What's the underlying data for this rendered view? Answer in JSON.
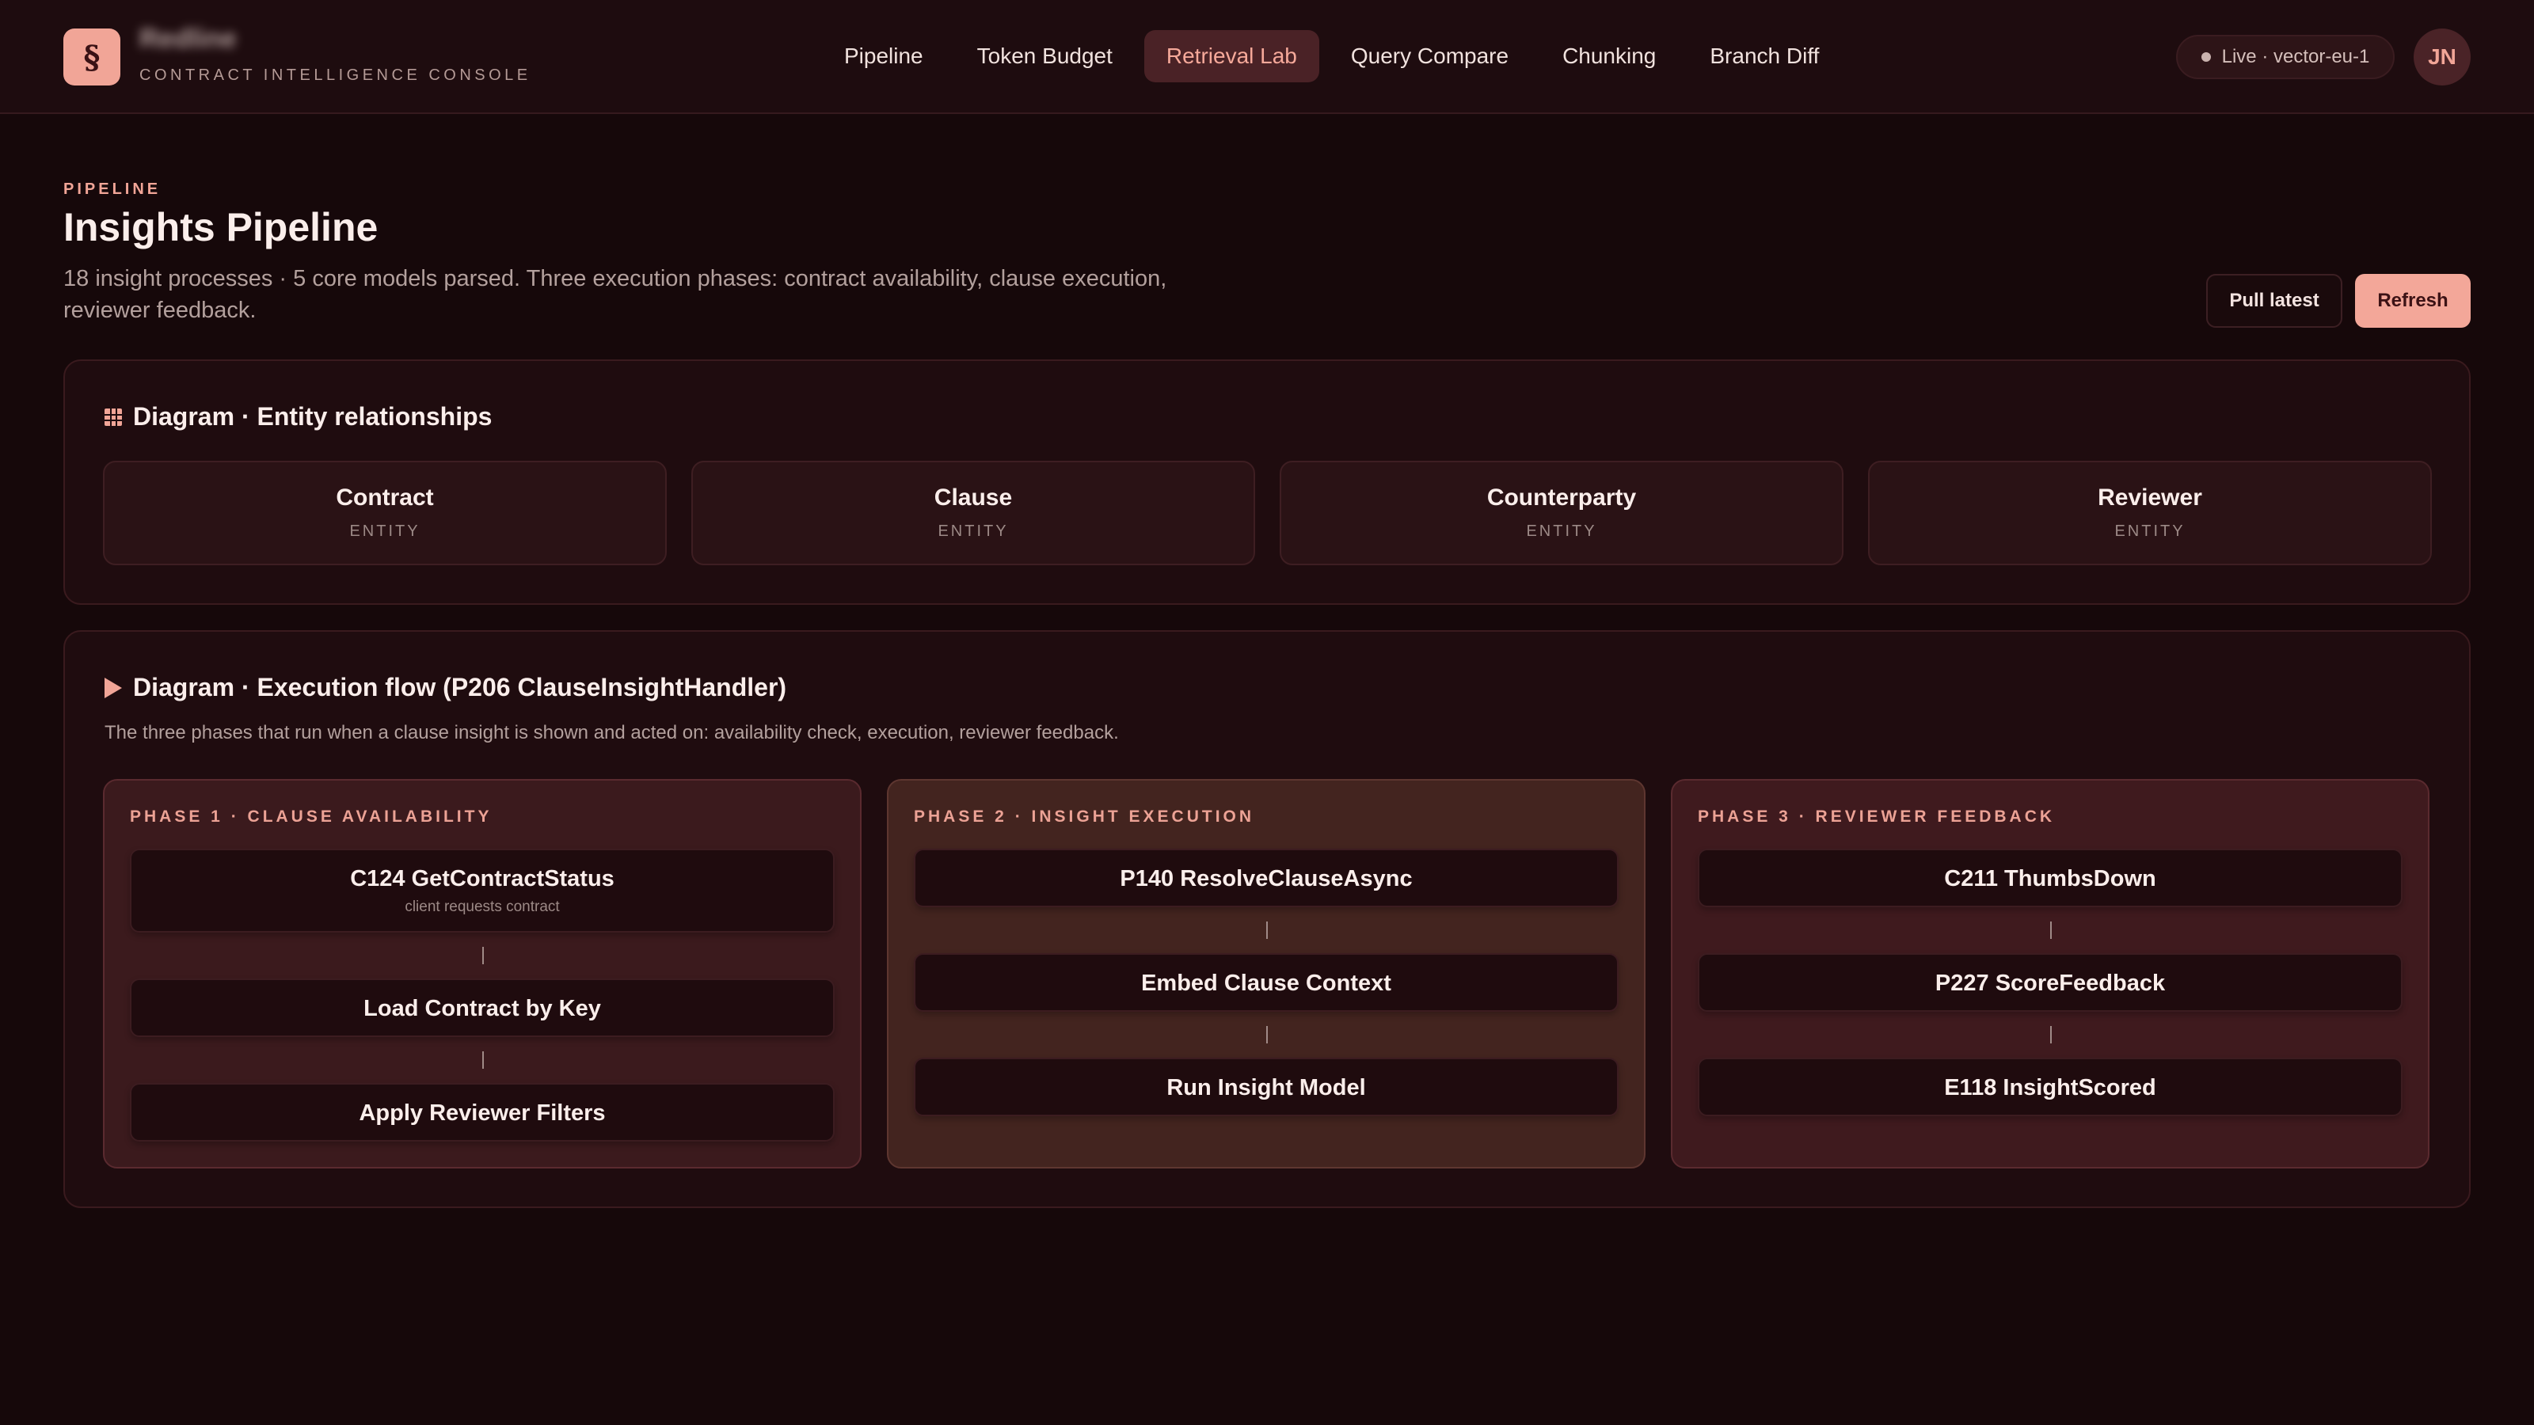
{
  "app": {
    "logo_glyph": "§",
    "brand_name": "Redline",
    "brand_subtitle": "CONTRACT INTELLIGENCE CONSOLE"
  },
  "nav": {
    "items": [
      {
        "label": "Pipeline",
        "active": false
      },
      {
        "label": "Token Budget",
        "active": false
      },
      {
        "label": "Retrieval Lab",
        "active": true
      },
      {
        "label": "Query Compare",
        "active": false
      },
      {
        "label": "Chunking",
        "active": false
      },
      {
        "label": "Branch Diff",
        "active": false
      }
    ]
  },
  "status": {
    "live_label": "Live · vector-eu-1"
  },
  "user": {
    "initials": "JN"
  },
  "header": {
    "eyebrow": "PIPELINE",
    "title": "Insights Pipeline",
    "description": "18 insight processes · 5 core models parsed. Three execution phases: contract availability, clause execution, reviewer feedback.",
    "pull_label": "Pull latest",
    "refresh_label": "Refresh"
  },
  "entities_panel": {
    "title": "Diagram · Entity relationships",
    "icon": "grid-icon",
    "entities": [
      {
        "name": "Contract",
        "type": "ENTITY"
      },
      {
        "name": "Clause",
        "type": "ENTITY"
      },
      {
        "name": "Counterparty",
        "type": "ENTITY"
      },
      {
        "name": "Reviewer",
        "type": "ENTITY"
      }
    ]
  },
  "flow_panel": {
    "title": "Diagram · Execution flow (P206 ClauseInsightHandler)",
    "icon": "play-icon",
    "description": "The three phases that run when a clause insight is shown and acted on: availability check, execution, reviewer feedback.",
    "phases": [
      {
        "label": "PHASE 1 · CLAUSE AVAILABILITY",
        "steps": [
          {
            "title": "C124 GetContractStatus",
            "subtitle": "client requests contract"
          },
          {
            "title": "Load Contract by Key",
            "subtitle": ""
          },
          {
            "title": "Apply Reviewer Filters",
            "subtitle": ""
          }
        ]
      },
      {
        "label": "PHASE 2 · INSIGHT EXECUTION",
        "steps": [
          {
            "title": "P140 ResolveClauseAsync",
            "subtitle": ""
          },
          {
            "title": "Embed Clause Context",
            "subtitle": ""
          },
          {
            "title": "Run Insight Model",
            "subtitle": ""
          }
        ]
      },
      {
        "label": "PHASE 3 · REVIEWER FEEDBACK",
        "steps": [
          {
            "title": "C211 ThumbsDown",
            "subtitle": ""
          },
          {
            "title": "P227 ScoreFeedback",
            "subtitle": ""
          },
          {
            "title": "E118 InsightScored",
            "subtitle": ""
          }
        ]
      }
    ]
  },
  "colors": {
    "background": "#16080a",
    "accent": "#f3a799",
    "panel": "#1f0c0f"
  }
}
